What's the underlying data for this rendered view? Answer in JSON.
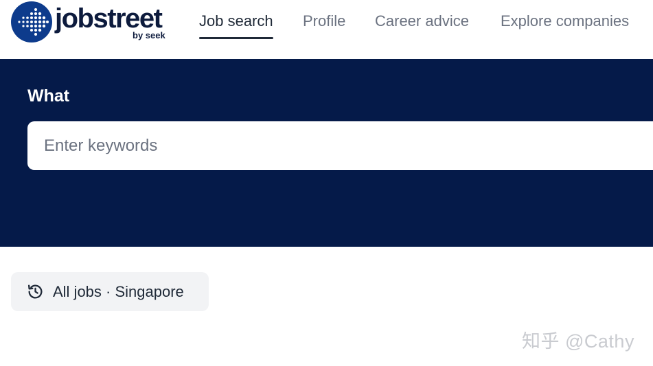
{
  "brand": {
    "name": "jobstreet",
    "sub": "by seek",
    "color": "#0d1b3d"
  },
  "nav": {
    "items": [
      {
        "label": "Job search",
        "active": true
      },
      {
        "label": "Profile",
        "active": false
      },
      {
        "label": "Career advice",
        "active": false
      },
      {
        "label": "Explore companies",
        "active": false
      }
    ]
  },
  "hero": {
    "background": "#051a49",
    "what_label": "What",
    "search_placeholder": "Enter keywords",
    "search_value": ""
  },
  "recent": {
    "icon": "history-icon",
    "label": "All jobs · Singapore"
  },
  "watermark": {
    "text": "知乎 @Cathy"
  }
}
